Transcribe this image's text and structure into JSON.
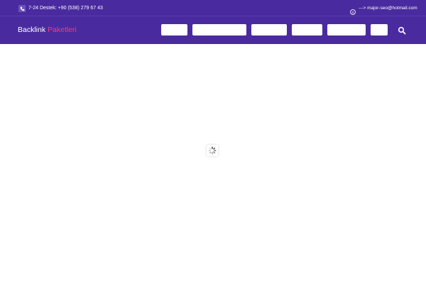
{
  "topbar": {
    "phone_icon": "phone-icon",
    "phone_text": "7-24 Destek: +90 (538) 279 67 43",
    "skype_icon": "skype-icon",
    "email_text": "---> major-seo@hotmail.com"
  },
  "brand": {
    "part1": "Backlink",
    "part2": "Paketleri",
    "part2_color": "#ff3b6b"
  },
  "nav": {
    "items": [
      {
        "label": ""
      },
      {
        "label": ""
      },
      {
        "label": ""
      },
      {
        "label": ""
      },
      {
        "label": ""
      },
      {
        "label": ""
      }
    ],
    "search_icon": "search-icon"
  },
  "colors": {
    "header_bg": "#4a2a9f",
    "accent": "#ff3b6b"
  },
  "loader": {
    "icon": "spinner-icon"
  }
}
